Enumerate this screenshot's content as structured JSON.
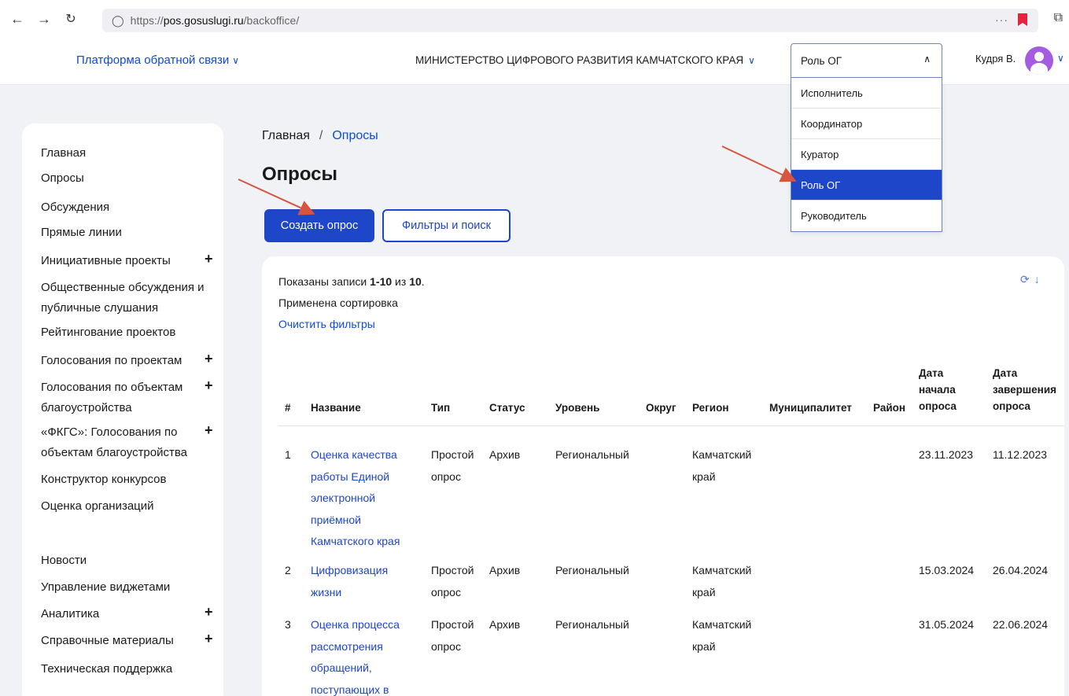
{
  "browser": {
    "url_prefix": "https://",
    "url_host": "pos.gosuslugi.ru",
    "url_path": "/backoffice/"
  },
  "header": {
    "platform_label": "Платформа обратной связи",
    "ministry_label": "МИНИСТЕРСТВО ЦИФРОВОГО РАЗВИТИЯ КАМЧАТСКОГО КРАЯ",
    "role_selected": "Роль ОГ",
    "user_name": "Кудря В."
  },
  "role_dropdown": {
    "options": [
      "Исполнитель",
      "Координатор",
      "Куратор",
      "Роль ОГ",
      "Руководитель"
    ],
    "active_index": 3
  },
  "sidebar": {
    "items": [
      {
        "label": "Главная",
        "plus": false
      },
      {
        "label": "Опросы",
        "plus": false
      },
      {
        "label": "Обсуждения",
        "plus": false
      },
      {
        "label": "Прямые линии",
        "plus": false
      },
      {
        "label": "Инициативные проекты",
        "plus": true
      },
      {
        "label": "Общественные обсуждения и публичные слушания",
        "plus": false
      },
      {
        "label": "Рейтингование проектов",
        "plus": false
      },
      {
        "label": "Голосования по проектам",
        "plus": true
      },
      {
        "label": "Голосования по объектам благоустройства",
        "plus": true
      },
      {
        "label": "«ФКГС»: Голосования по объектам благоустройства",
        "plus": true
      },
      {
        "label": "Конструктор конкурсов",
        "plus": false
      },
      {
        "label": "Оценка организаций",
        "plus": false
      },
      {
        "label": "Новости",
        "plus": false
      },
      {
        "label": "Управление виджетами",
        "plus": false
      },
      {
        "label": "Аналитика",
        "plus": true
      },
      {
        "label": "Справочные материалы",
        "plus": true
      },
      {
        "label": "Техническая поддержка",
        "plus": false
      }
    ]
  },
  "main": {
    "breadcrumb_home": "Главная",
    "breadcrumb_sep": "/",
    "breadcrumb_current": "Опросы",
    "title": "Опросы",
    "create_button": "Создать опрос",
    "filter_button": "Фильтры и поиск",
    "summary_prefix": "Показаны записи ",
    "summary_range": "1-10",
    "summary_mid": " из ",
    "summary_total": "10",
    "summary_suffix": ".",
    "sorting_applied": "Применена сортировка",
    "clear_filters": "Очистить фильтры"
  },
  "table": {
    "columns": [
      "#",
      "Название",
      "Тип",
      "Статус",
      "Уровень",
      "Округ",
      "Регион",
      "Муниципалитет",
      "Район",
      "Дата начала опроса",
      "Дата завершения опроса"
    ],
    "rows": [
      {
        "num": "1",
        "name": "Оценка качества работы Единой электронной приёмной Камчатского края",
        "type": "Простой опрос",
        "status": "Архив",
        "level": "Региональный",
        "district": "",
        "region": "Камчатский край",
        "municipality": "",
        "area": "",
        "start": "23.11.2023",
        "end": "11.12.2023"
      },
      {
        "num": "2",
        "name": "Цифровизация жизни",
        "type": "Простой опрос",
        "status": "Архив",
        "level": "Региональный",
        "district": "",
        "region": "Камчатский край",
        "municipality": "",
        "area": "",
        "start": "15.03.2024",
        "end": "26.04.2024"
      },
      {
        "num": "3",
        "name": "Оценка процесса рассмотрения обращений, поступающих в",
        "type": "Простой опрос",
        "status": "Архив",
        "level": "Региональный",
        "district": "",
        "region": "Камчатский край",
        "municipality": "",
        "area": "",
        "start": "31.05.2024",
        "end": "22.06.2024"
      }
    ]
  },
  "colors": {
    "primary": "#1e46c8",
    "link": "#0d4cd3",
    "annotation_arrow": "#d9533d",
    "avatar": "#a45ce0"
  }
}
